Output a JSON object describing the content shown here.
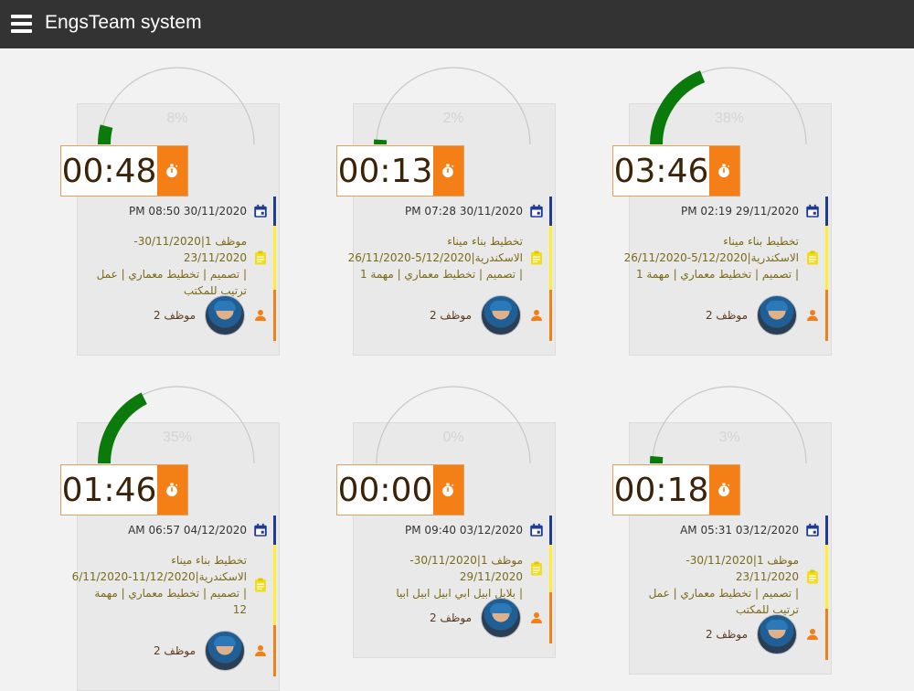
{
  "app": {
    "title": "EngsTeam system"
  },
  "colors": {
    "gauge_fill": "#0a7a0a",
    "gauge_track": "#c8c8c8",
    "timer_button": "#f57f17",
    "date_bar": "#1f3a93",
    "task_bar": "#ffee33",
    "person_bar": "#f57f17"
  },
  "icons": {
    "menu": "hamburger-menu-icon",
    "timer": "stopwatch-icon",
    "date": "calendar-icon",
    "task": "clipboard-icon",
    "person": "person-icon"
  },
  "cards": [
    {
      "progress_label": "8%",
      "progress": 0.08,
      "timer": "00:48",
      "date": "PM 08:50 30/11/2020",
      "task_lines": [
        "موظف 1|30/11/2020-23/11/2020",
        "| تصميم | تخطيط معماري | عمل",
        "ترتيب للمكتب"
      ],
      "employee": "موظف 2"
    },
    {
      "progress_label": "2%",
      "progress": 0.02,
      "timer": "00:13",
      "date": "PM 07:28 30/11/2020",
      "task_lines": [
        "تخطيط بناء ميناء",
        "الاسكندرية|5/12/2020-26/11/2020",
        "| تصميم | تخطيط معماري | مهمة 1"
      ],
      "employee": "موظف 2"
    },
    {
      "progress_label": "38%",
      "progress": 0.38,
      "timer": "03:46",
      "date": "PM 02:19 29/11/2020",
      "task_lines": [
        "تخطيط بناء ميناء",
        "الاسكندرية|5/12/2020-26/11/2020",
        "| تصميم | تخطيط معماري | مهمة 1"
      ],
      "employee": "موظف 2"
    },
    {
      "progress_label": "35%",
      "progress": 0.35,
      "timer": "01:46",
      "date": "AM 06:57 04/12/2020",
      "task_lines": [
        "تخطيط بناء ميناء",
        "الاسكندرية|11/12/2020-6/11/2020",
        "| تصميم | تخطيط معماري | مهمة",
        "12"
      ],
      "employee": "موظف 2"
    },
    {
      "progress_label": "0%",
      "progress": 0.0,
      "timer": "00:00",
      "date": "PM 09:40 03/12/2020",
      "task_lines": [
        "موظف 1|30/11/2020-29/11/2020",
        "| بلابل ابيل ابي ابيل ابيل ابيا"
      ],
      "employee": "موظف 2"
    },
    {
      "progress_label": "3%",
      "progress": 0.03,
      "timer": "00:18",
      "date": "AM 05:31 03/12/2020",
      "task_lines": [
        "موظف 1|30/11/2020-23/11/2020",
        "| تصميم | تخطيط معماري | عمل",
        "ترتيب للمكتب"
      ],
      "employee": "موظف 2"
    }
  ]
}
